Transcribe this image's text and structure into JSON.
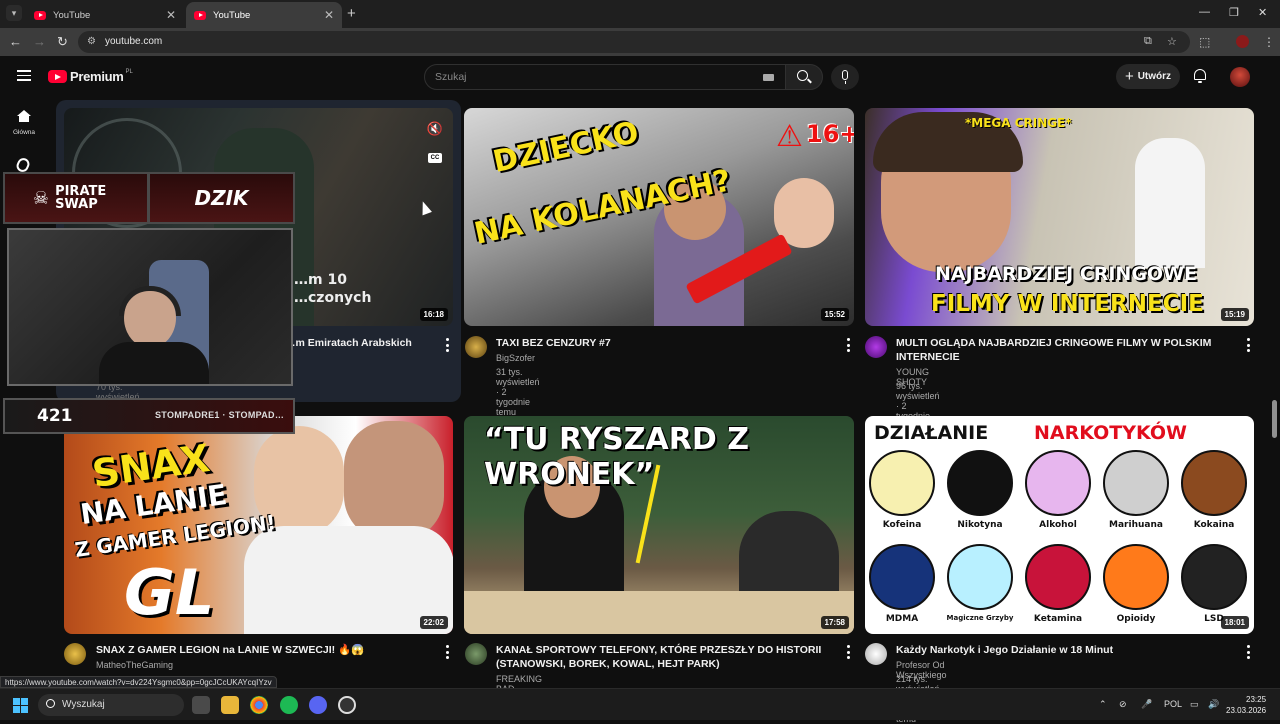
{
  "browser": {
    "tabs": [
      {
        "title": "YouTube",
        "active": false
      },
      {
        "title": "YouTube",
        "active": true
      }
    ],
    "url": "youtube.com",
    "status_url": "https://www.youtube.com/watch?v=dv224Ysgmc0&pp=0gcJCcUKAYcqIYzv"
  },
  "header": {
    "logo_text": "Premium",
    "country_code": "PL",
    "search_placeholder": "Szukaj",
    "create_label": "Utwórz"
  },
  "sidebar": {
    "home_label": "Główna"
  },
  "videos": [
    {
      "title": "…m Emiratach Arabskich",
      "thumb_text": "…m 10\n…czonych",
      "meta": "70 tys. wyświetleń · 6 dni temu",
      "duration": "16:18"
    },
    {
      "title": "TAXI BEZ CENZURY #7",
      "channel": "BigSzofer",
      "meta": "31 tys. wyświetleń · 2 tygodnie temu",
      "duration": "15:52",
      "thumb_text_1": "DZIECKO",
      "thumb_text_2": "NA KOLANACH?",
      "badge": "16+"
    },
    {
      "title": "MULTI OGLĄDA NAJBARDZIEJ CRINGOWE FILMY W POLSKIM INTERNECIE",
      "channel": "YOUNG SHOTY",
      "meta": "96 tys. wyświetleń · 2 tygodnie temu",
      "duration": "15:19",
      "thumb_tag": "*MEGA CRINGE*",
      "thumb_text_1": "NAJBARDZIEJ CRINGOWE",
      "thumb_text_2": "FILMY W INTERNECIE"
    },
    {
      "title": "SNAX Z GAMER LEGION na LANIE W SZWECJI! 🔥😱",
      "channel": "MatheoTheGaming",
      "duration": "22:02",
      "thumb_text_1": "SNAX",
      "thumb_text_2": "NA LANIE",
      "thumb_text_3": "Z GAMER LEGION!",
      "thumb_logo": "GL"
    },
    {
      "title": "KANAŁ SPORTOWY TELEFONY, KTÓRE PRZESZŁY DO HISTORII (STANOWSKI, BOREK, KOWAL, HEJT PARK)",
      "channel": "FREAKING BAD",
      "duration": "17:58",
      "thumb_text_1": "“TU RYSZARD Z WRONEK”"
    },
    {
      "title": "Każdy Narkotyk i Jego Działanie w 18 Minut",
      "channel": "Profesor Od Wszystkiego",
      "meta": "214 tys. wyświetleń · 4 miesiące temu",
      "duration": "18:01",
      "thumb_heading_1": "DZIAŁANIE",
      "thumb_heading_2": "NARKOTYKÓW",
      "substances": [
        "Kofeina",
        "Nikotyna",
        "Alkohol",
        "Marihuana",
        "Kokaina",
        "MDMA",
        "Magiczne Grzyby",
        "Ketamina",
        "Opioidy",
        "LSD"
      ],
      "substance_colors": [
        "#f7f0b0",
        "#111111",
        "#e7b6ee",
        "#cfcfcf",
        "#8b4a1f",
        "#16337a",
        "#b8f0ff",
        "#c8133a",
        "#ff7a1a",
        "#222222"
      ]
    }
  ],
  "overlay": {
    "sponsor_1": "PIRATE SWAP",
    "sponsor_2": "DZIK",
    "counter": "421",
    "handle": "STOMPADRE1 · STOMPAD…"
  },
  "taskbar": {
    "search_label": "Wyszukaj",
    "lang": "POL",
    "time": "23:25",
    "date": "23.03.2026"
  }
}
